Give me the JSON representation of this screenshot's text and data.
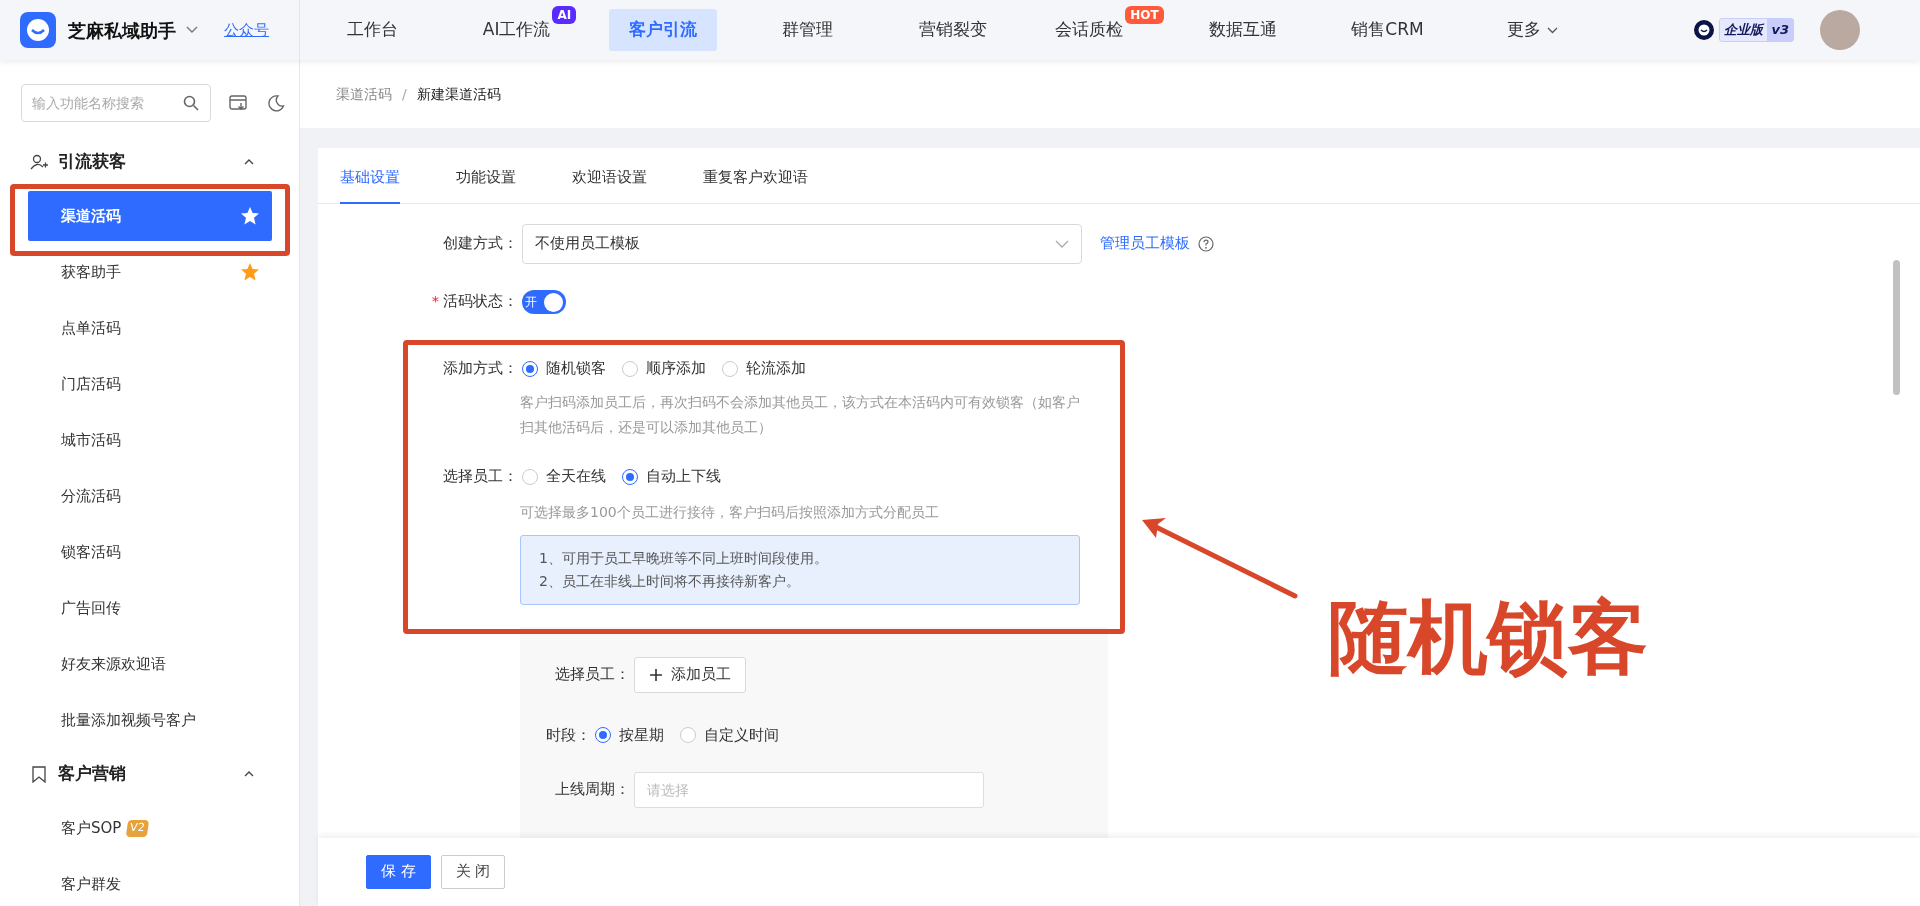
{
  "app": {
    "name": "芝麻私域助手",
    "account_link": "公众号"
  },
  "nav": [
    {
      "label": "工作台",
      "selected": false
    },
    {
      "label": "AI工作流",
      "selected": false,
      "badge": {
        "text": "AI",
        "color": "#5a2bff"
      }
    },
    {
      "label": "客户引流",
      "selected": true
    },
    {
      "label": "群管理",
      "selected": false
    },
    {
      "label": "营销裂变",
      "selected": false
    },
    {
      "label": "会话质检",
      "selected": false,
      "badge": {
        "text": "HOT",
        "color": "#ff5a3c"
      }
    },
    {
      "label": "数据互通",
      "selected": false
    },
    {
      "label": "销售CRM",
      "selected": false
    },
    {
      "label": "更多",
      "selected": false,
      "dropdown": true
    }
  ],
  "edition": {
    "label": "企业版",
    "version": "v3"
  },
  "sidebar": {
    "search": {
      "placeholder": "输入功能名称搜索"
    },
    "sections": [
      {
        "title": "引流获客",
        "kind": "users",
        "expanded": true,
        "items": [
          {
            "label": "渠道活码",
            "selected": true,
            "favorite": true
          },
          {
            "label": "获客助手",
            "selected": false,
            "favorite": true
          },
          {
            "label": "点单活码",
            "selected": false,
            "favorite": false
          },
          {
            "label": "门店活码",
            "selected": false,
            "favorite": false
          },
          {
            "label": "城市活码",
            "selected": false,
            "favorite": false
          },
          {
            "label": "分流活码",
            "selected": false,
            "favorite": false
          },
          {
            "label": "锁客活码",
            "selected": false,
            "favorite": false
          },
          {
            "label": "广告回传",
            "selected": false,
            "favorite": false
          },
          {
            "label": "好友来源欢迎语",
            "selected": false,
            "favorite": false
          },
          {
            "label": "批量添加视频号客户",
            "selected": false,
            "favorite": false
          }
        ]
      },
      {
        "title": "客户营销",
        "kind": "bookmark",
        "expanded": true,
        "items": [
          {
            "label": "客户SOP",
            "selected": false,
            "favorite": false,
            "badge": "V2"
          },
          {
            "label": "客户群发",
            "selected": false,
            "favorite": false
          }
        ]
      }
    ]
  },
  "breadcrumb": [
    "渠道活码",
    "新建渠道活码"
  ],
  "breadcrumb_separator": "/",
  "tabs": [
    {
      "label": "基础设置",
      "selected": true
    },
    {
      "label": "功能设置",
      "selected": false
    },
    {
      "label": "欢迎语设置",
      "selected": false
    },
    {
      "label": "重复客户欢迎语",
      "selected": false
    }
  ],
  "form": {
    "create_method": {
      "label": "创建方式：",
      "value": "不使用员工模板",
      "link": "管理员工模板"
    },
    "status": {
      "label": "活码状态：",
      "required_mark": "*",
      "on": true,
      "text": "开"
    },
    "add_method": {
      "label": "添加方式：",
      "options": [
        {
          "label": "随机锁客",
          "selected": true
        },
        {
          "label": "顺序添加",
          "selected": false
        },
        {
          "label": "轮流添加",
          "selected": false
        }
      ],
      "help": "客户扫码添加员工后，再次扫码不会添加其他员工，该方式在本活码内可有效锁客（如客户扫其他活码后，还是可以添加其他员工）"
    },
    "staff_mode": {
      "label": "选择员工：",
      "options": [
        {
          "label": "全天在线",
          "selected": false
        },
        {
          "label": "自动上下线",
          "selected": true
        }
      ],
      "help": "可选择最多100个员工进行接待，客户扫码后按照添加方式分配员工",
      "notes": [
        "1、可用于员工早晚班等不同上班时间段使用。",
        "2、员工在非线上时间将不再接待新客户。"
      ]
    },
    "staff_select": {
      "label": "选择员工：",
      "button": "添加员工"
    },
    "period": {
      "label": "时段：",
      "options": [
        {
          "label": "按星期",
          "selected": true
        },
        {
          "label": "自定义时间",
          "selected": false
        }
      ]
    },
    "online_cycle": {
      "label": "上线周期：",
      "placeholder": "请选择"
    }
  },
  "footer_buttons": [
    {
      "label": "保 存",
      "kind": "primary"
    },
    {
      "label": "关 闭",
      "kind": "default"
    }
  ],
  "annotation": {
    "text": "随机锁客"
  }
}
